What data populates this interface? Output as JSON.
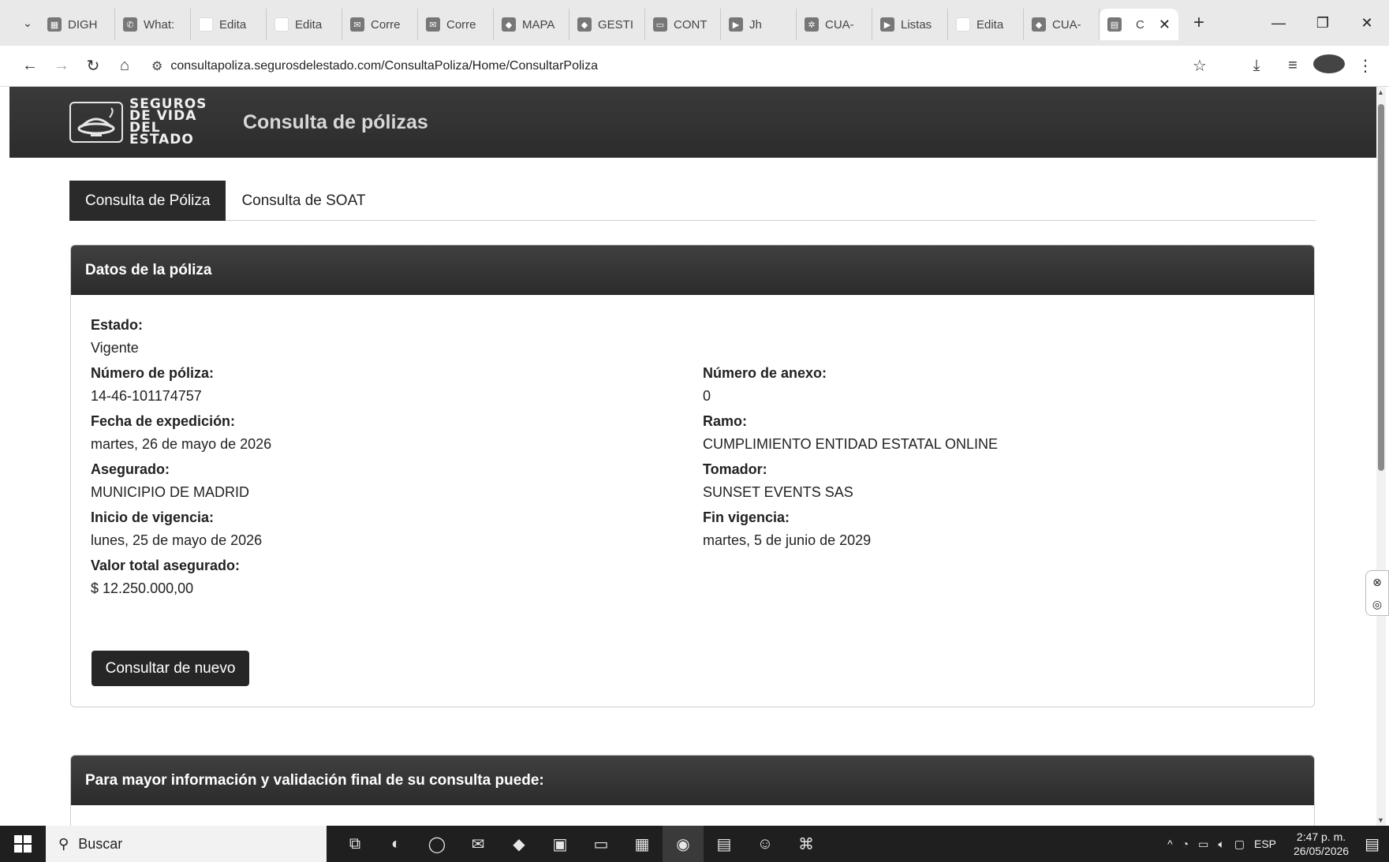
{
  "browser": {
    "tabs": [
      {
        "label": "DIGH",
        "icon": "spreadsheet-icon"
      },
      {
        "label": "What:",
        "icon": "whatsapp-icon"
      },
      {
        "label": "Edita",
        "icon": "blank-page-icon"
      },
      {
        "label": "Edita",
        "icon": "blank-page-icon"
      },
      {
        "label": "Corre",
        "icon": "mail-icon"
      },
      {
        "label": "Corre",
        "icon": "mail-icon"
      },
      {
        "label": "MAPA",
        "icon": "app-icon"
      },
      {
        "label": "GESTI",
        "icon": "app-icon"
      },
      {
        "label": "CONT",
        "icon": "slides-icon"
      },
      {
        "label": "Jh",
        "icon": "youtube-icon"
      },
      {
        "label": "CUA-",
        "icon": "chatgpt-icon"
      },
      {
        "label": "Listas",
        "icon": "youtube-icon"
      },
      {
        "label": "Edita",
        "icon": "blank-page-icon"
      },
      {
        "label": "CUA-",
        "icon": "app-icon"
      }
    ],
    "active_tab": {
      "label": "C",
      "close": "✕"
    },
    "new_tab": "+",
    "url": "consultapoliza.segurosdelestado.com/ConsultaPoliza/Home/ConsultarPoliza"
  },
  "site": {
    "logo_text": "SEGUROS\nDE VIDA DEL\nESTADO",
    "title": "Consulta de pólizas"
  },
  "page_tabs": {
    "poliza": "Consulta de Póliza",
    "soat": "Consulta de SOAT"
  },
  "card": {
    "header": "Datos de la póliza",
    "estado": {
      "label": "Estado:",
      "value": "Vigente"
    },
    "numero_poliza": {
      "label": "Número de póliza:",
      "value": "14-46-101174757"
    },
    "numero_anexo": {
      "label": "Número de anexo:",
      "value": "0"
    },
    "fecha_expedicion": {
      "label": "Fecha de expedición:",
      "value": "martes, 26 de mayo de 2026"
    },
    "ramo": {
      "label": "Ramo:",
      "value": "CUMPLIMIENTO ENTIDAD ESTATAL ONLINE"
    },
    "asegurado": {
      "label": "Asegurado:",
      "value": "MUNICIPIO DE MADRID"
    },
    "tomador": {
      "label": "Tomador:",
      "value": "SUNSET EVENTS SAS"
    },
    "inicio_vigencia": {
      "label": "Inicio de vigencia:",
      "value": "lunes, 25 de mayo de 2026"
    },
    "fin_vigencia": {
      "label": "Fin vigencia:",
      "value": "martes, 5 de junio de 2029"
    },
    "valor_total": {
      "label": "Valor total asegurado:",
      "value": "$ 12.250.000,00"
    },
    "button": "Consultar de nuevo"
  },
  "card2": {
    "header": "Para mayor información y validación final de su consulta puede:"
  },
  "taskbar": {
    "search_label": "Buscar",
    "language": "ESP",
    "time": "2:47 p. m.",
    "date": "26/05/2026"
  },
  "colors": {
    "header_bg": "#2c2c2c",
    "button_bg": "#262626"
  }
}
